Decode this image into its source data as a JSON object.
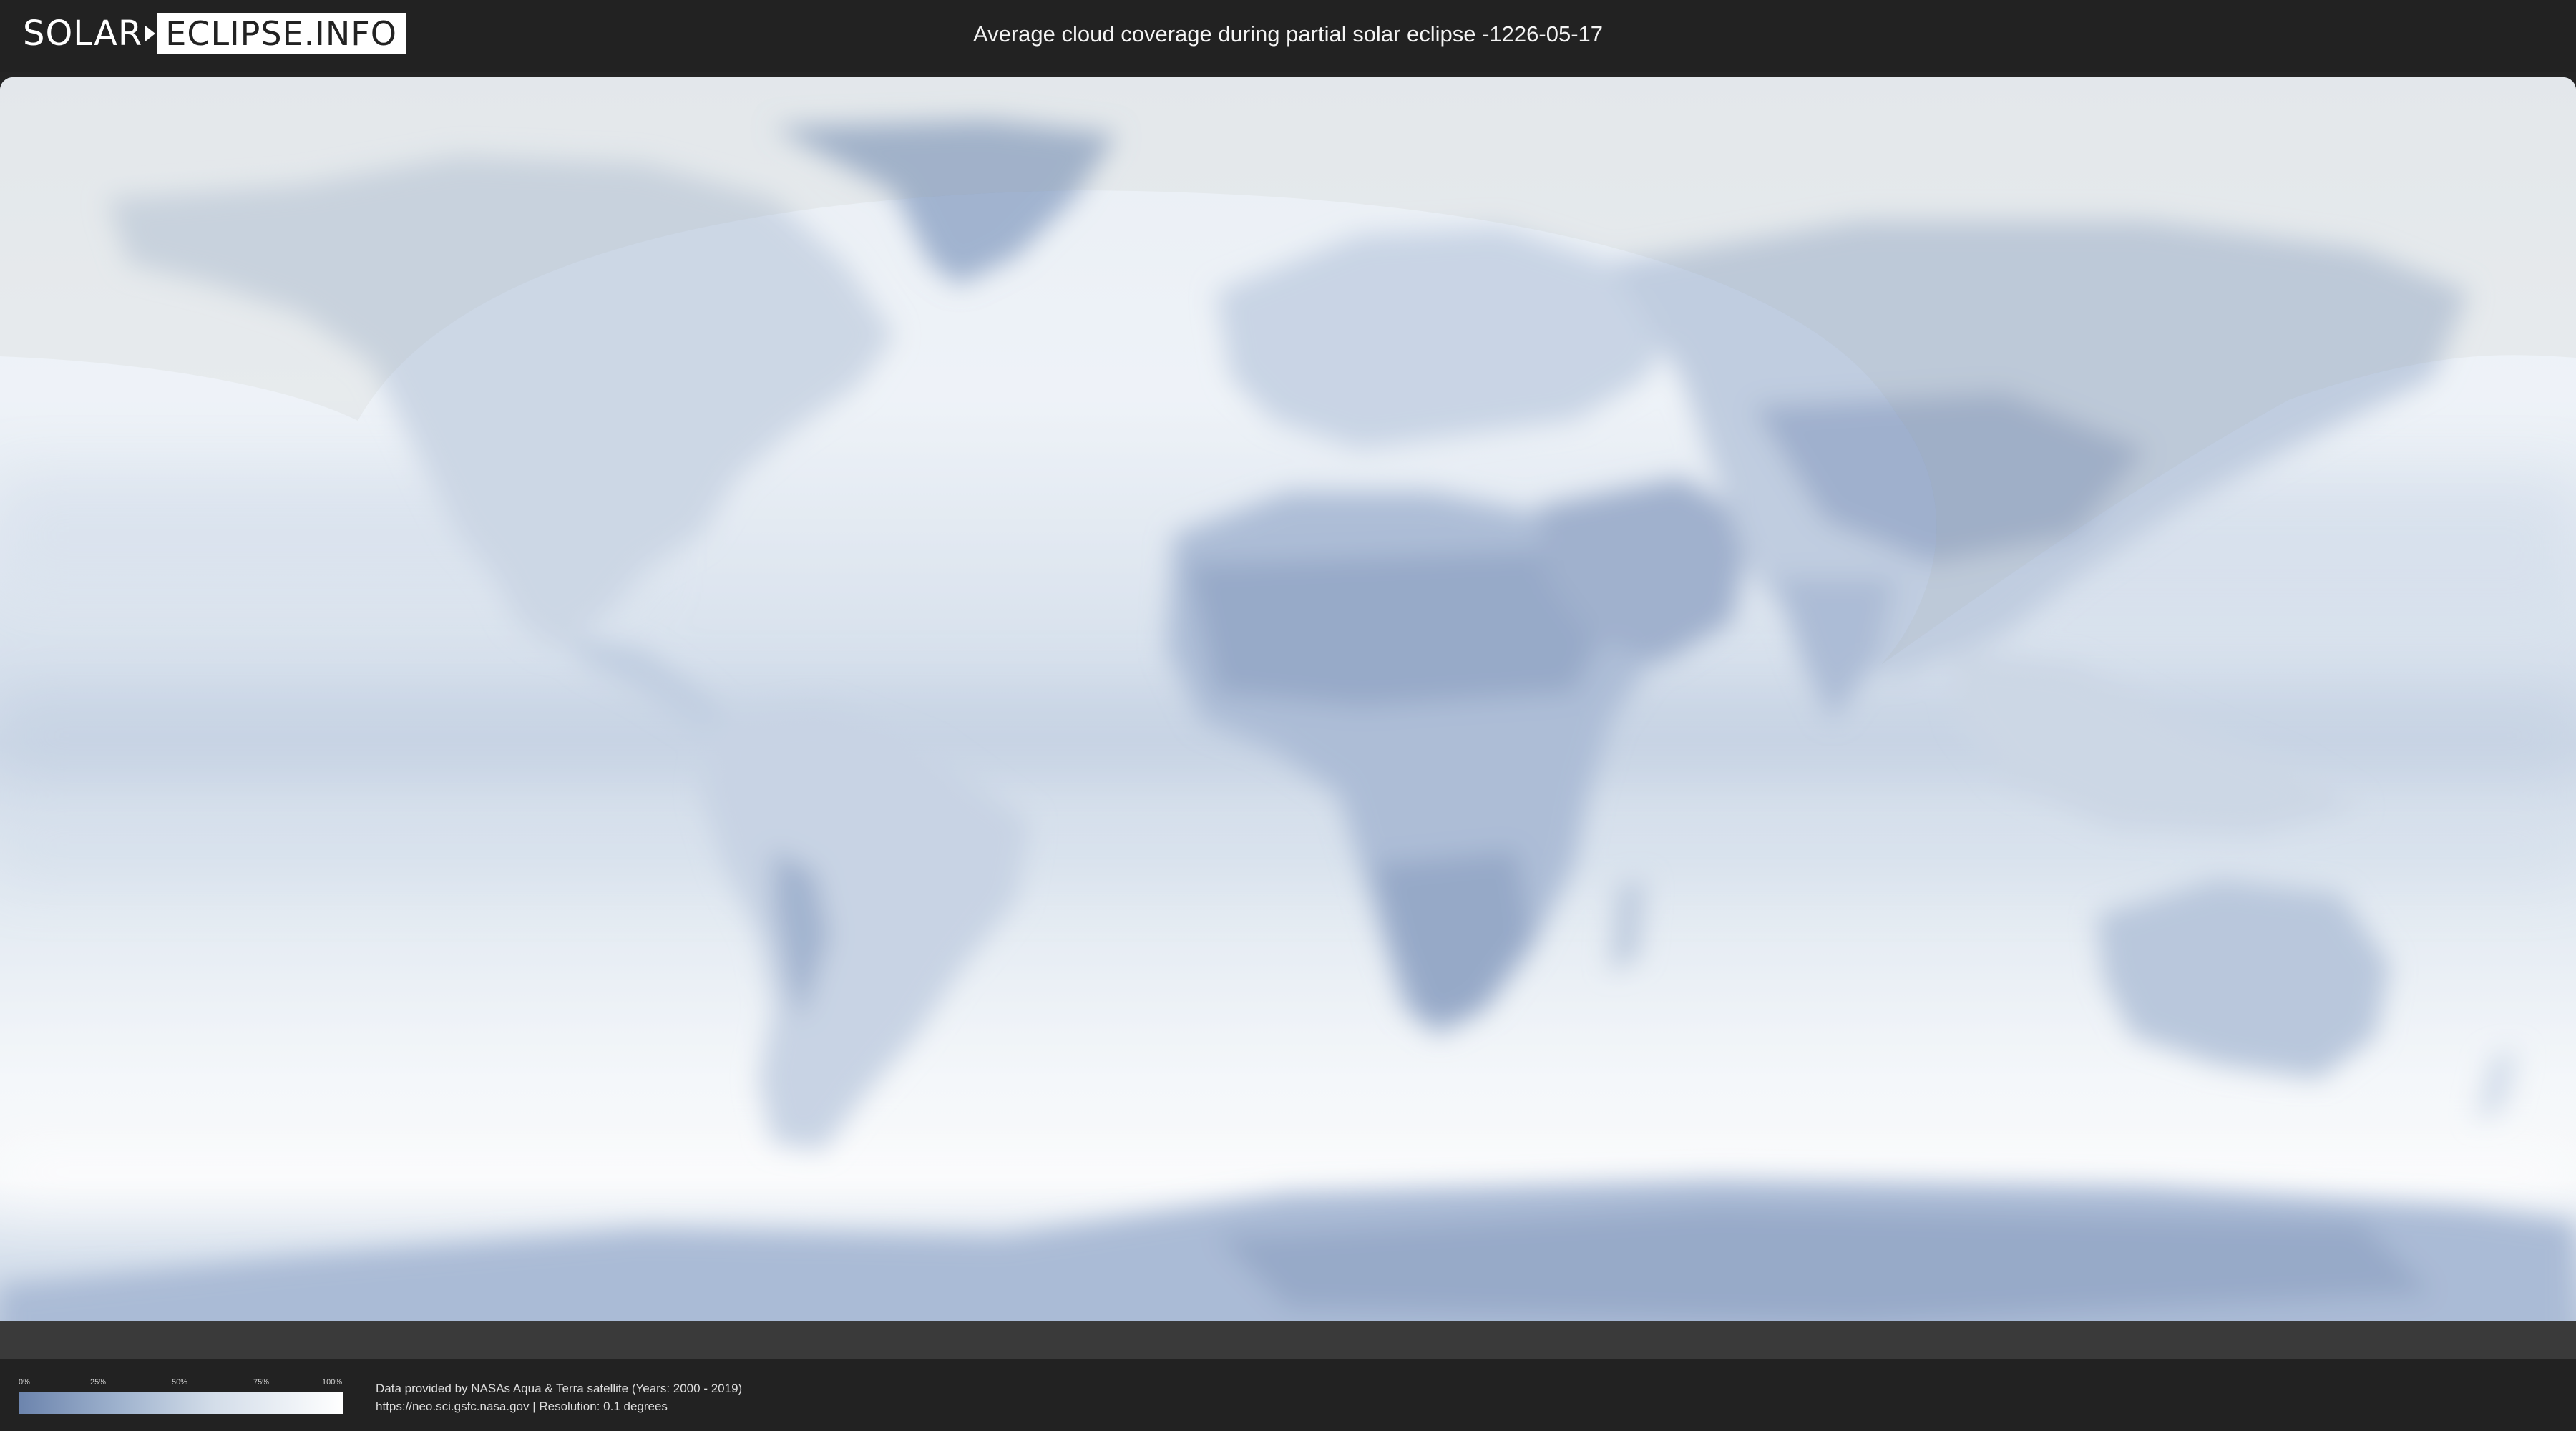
{
  "header": {
    "logo_left": "SOLAR",
    "logo_right": "ECLIPSE.INFO",
    "title": "Average cloud coverage during partial solar eclipse -1226-05-17"
  },
  "map": {
    "ocean_color": "#dbe6f1",
    "land_color": "#a4b6d0",
    "dry_region_color": "#7f97bd",
    "eclipse_zone_color": "#ffffff",
    "outside_zone_tint": "#e6e4e0"
  },
  "legend": {
    "ticks": [
      "0%",
      "25%",
      "50%",
      "75%",
      "100%"
    ],
    "gradient": [
      "#6c84ad",
      "#9db1cd",
      "#d3dde9",
      "#ffffff"
    ]
  },
  "footer": {
    "credit_line1": "Data provided by NASAs Aqua & Terra satellite (Years: 2000 - 2019)",
    "credit_line2": "https://neo.sci.gsfc.nasa.gov | Resolution: 0.1 degrees"
  }
}
